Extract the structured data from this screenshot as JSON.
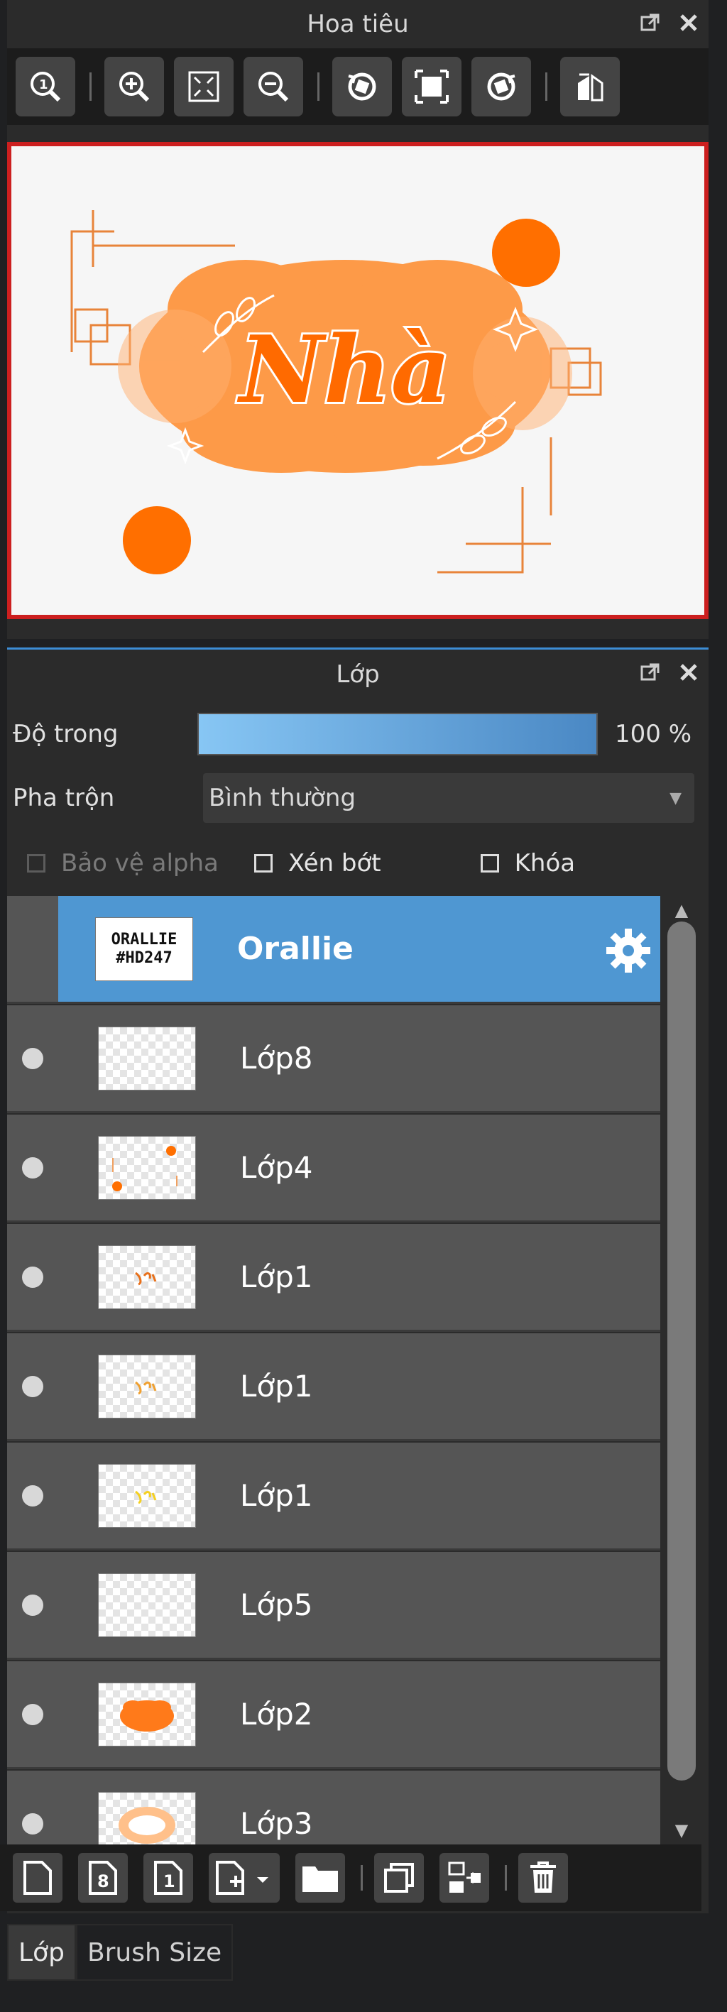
{
  "navigator": {
    "title": "Hoa tiêu",
    "toolbar_icons": [
      "zoom-reset-icon",
      "zoom-in-icon",
      "fit-screen-icon",
      "zoom-out-icon",
      "rotate-left-icon",
      "fit-window-icon",
      "rotate-right-icon",
      "flip-horizontal-icon"
    ]
  },
  "canvas": {
    "artwork_text": "Nhà",
    "accent": "#ff7a1a"
  },
  "layer_panel": {
    "title": "Lớp",
    "opacity_label": "Độ trong",
    "opacity_value": "100 %",
    "opacity_fraction": 1.0,
    "blend_label": "Pha trộn",
    "blend_value": "Bình thường",
    "protect_alpha": "Bảo vệ alpha",
    "clipping": "Xén bớt",
    "lock": "Khóa"
  },
  "layers": [
    {
      "name": "Orallie",
      "selected": true,
      "thumb_text_1": "ORALLIE",
      "thumb_text_2": "#HD247"
    },
    {
      "name": "Lớp8"
    },
    {
      "name": "Lớp4"
    },
    {
      "name": "Lớp1"
    },
    {
      "name": "Lớp1"
    },
    {
      "name": "Lớp1"
    },
    {
      "name": "Lớp5"
    },
    {
      "name": "Lớp2"
    },
    {
      "name": "Lớp3"
    }
  ],
  "layer_toolbar_icons": [
    "new-layer-icon",
    "new-8bit-layer-icon",
    "new-1bit-layer-icon",
    "add-layer-dropdown-icon",
    "folder-icon",
    "duplicate-layer-icon",
    "merge-down-icon",
    "delete-layer-icon"
  ],
  "tabs": [
    "Lớp",
    "Brush Size"
  ],
  "colors": {
    "selection": "#4f97d2",
    "frame": "#cc1f1f",
    "orange": "#ff7a1a"
  }
}
